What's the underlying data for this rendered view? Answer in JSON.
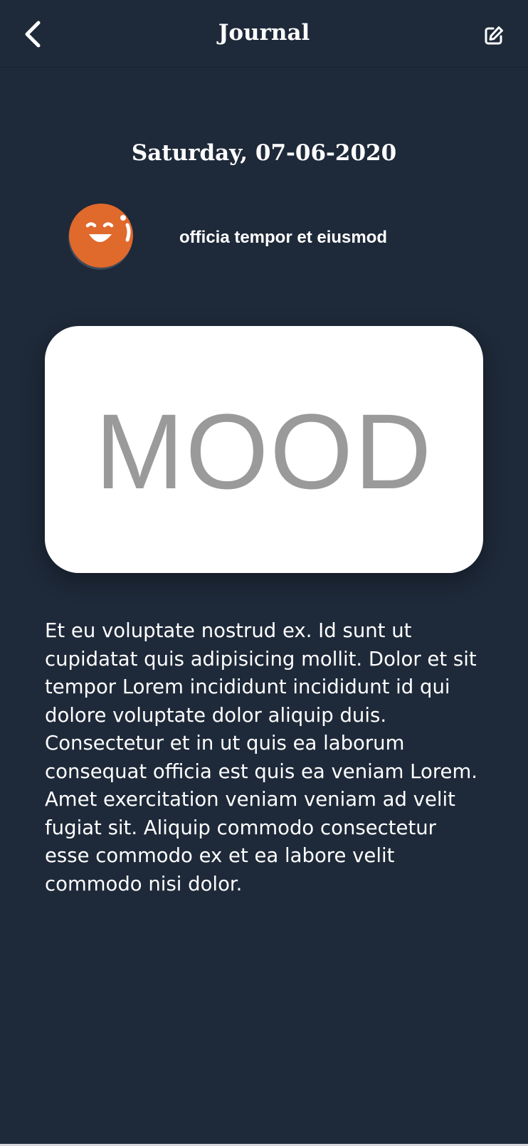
{
  "header": {
    "title": "Journal",
    "back_icon": "chevron-left-icon",
    "edit_icon": "edit-icon"
  },
  "entry": {
    "date": "Saturday, 07-06-2020",
    "title": "officia tempor et eiusmod",
    "mood_label": "MOOD",
    "body": "Et eu voluptate nostrud ex. Id sunt ut cupidatat quis adipisicing mollit. Dolor et sit tempor Lorem incididunt incididunt id qui dolore voluptate dolor aliquip duis. Consectetur et in ut quis ea laborum consequat officia est quis ea veniam Lorem. Amet exercitation veniam veniam ad velit fugiat sit. Aliquip commodo consectetur esse commodo ex et ea labore velit commodo nisi dolor."
  },
  "colors": {
    "background": "#1e2939",
    "avatar": "#e0692c",
    "card": "#ffffff",
    "mood_text": "#9a9a9a"
  }
}
